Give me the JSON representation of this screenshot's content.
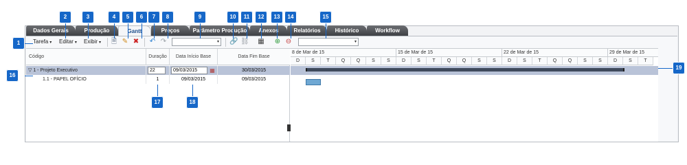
{
  "tabs": [
    {
      "label": "Dados Gerais"
    },
    {
      "label": "Produção"
    },
    {
      "label": "Gantt"
    },
    {
      "label": "Preços"
    },
    {
      "label": "Parâmetro Produção"
    },
    {
      "label": "Anexos"
    },
    {
      "label": "Relatórios"
    },
    {
      "label": "Histórico"
    },
    {
      "label": "Workflow"
    }
  ],
  "toolbar": {
    "menus": [
      {
        "label": "Tarefa"
      },
      {
        "label": "Editar"
      },
      {
        "label": "Exibir"
      }
    ],
    "caret": "▾",
    "icons": {
      "new": "🗎",
      "edit": "✎",
      "delete": "✖",
      "undo": "↶",
      "redo": "↷",
      "link": "🔗",
      "unlink": "⛓",
      "table": "▦",
      "zoom_in": "⊕",
      "zoom_out": "⊖"
    },
    "combo1_value": "",
    "combo2_value": ""
  },
  "columns": {
    "code": "Código",
    "duration": "Duração",
    "start": "Data Início Base",
    "end": "Data Fim Base"
  },
  "rows": [
    {
      "code": "1 - Projeto Executivo",
      "duration": "22",
      "start": "09/03/2015",
      "end": "30/03/2015"
    },
    {
      "code": "1.1 - PAPEL OFÍCIO",
      "duration": "1",
      "start": "09/03/2015",
      "end": "09/03/2015"
    }
  ],
  "weeks": [
    "8 de Mar de 15",
    "15 de Mar de 15",
    "22 de Mar de 15",
    "29 de Mar de 15"
  ],
  "days": [
    "D",
    "S",
    "T",
    "Q",
    "Q",
    "S",
    "S",
    "D",
    "S",
    "T",
    "Q",
    "Q",
    "S",
    "S",
    "D",
    "S",
    "T",
    "Q",
    "Q",
    "S",
    "S",
    "D",
    "S",
    "T"
  ],
  "callouts": [
    "1",
    "2",
    "3",
    "4",
    "5",
    "6",
    "7",
    "8",
    "9",
    "10",
    "11",
    "12",
    "13",
    "14",
    "15",
    "16",
    "17",
    "18",
    "19"
  ],
  "colors": {
    "badge": "#1667c8",
    "selected_row": "#b9c3d8",
    "task_bar": "#6fa8d3",
    "summary_bar": "#3f4a5c"
  }
}
